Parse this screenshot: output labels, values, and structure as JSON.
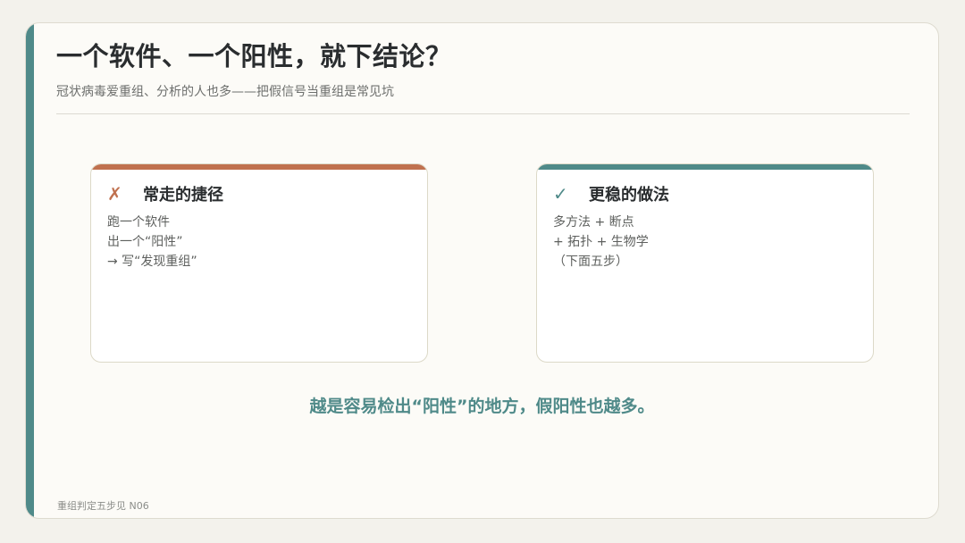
{
  "slide": {
    "title": "一个软件、一个阳性，就下结论？",
    "subtitle": "冠状病毒爱重组、分析的人也多——把假信号当重组是常见坑",
    "conclusion": "越是容易检出“阳性”的地方，假阳性也越多。",
    "footer": "重组判定五步见 N06"
  },
  "cards": {
    "shortcut": {
      "icon": "✗",
      "icon_name": "cross-icon",
      "title": "常走的捷径",
      "lines": [
        "跑一个软件",
        "出一个“阳性”",
        "→ 写“发现重组”"
      ]
    },
    "robust": {
      "icon": "✓",
      "icon_name": "check-icon",
      "title": "更稳的做法",
      "lines": [
        "多方法 + 断点",
        "+ 拓扑 + 生物学",
        "（下面五步）"
      ]
    }
  },
  "colors": {
    "accent_teal": "#4f8a89",
    "accent_orange": "#c0714f",
    "title_text": "#2a2d2f",
    "background": "#fcfbf7"
  }
}
